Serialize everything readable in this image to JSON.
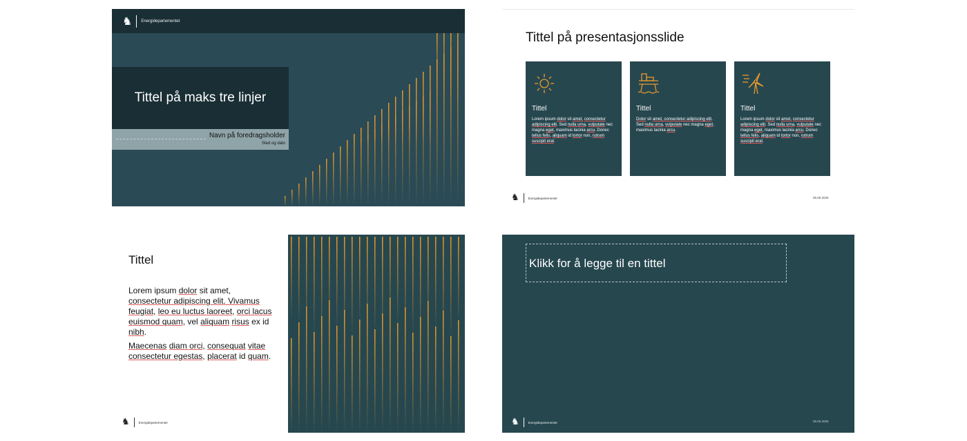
{
  "slide1": {
    "org": "Energidepartementet",
    "title": "Tittel på maks tre linjer",
    "speaker": "Navn på foredragsholder",
    "place_date": "Sted og dato"
  },
  "slide2": {
    "title": "Tittel på presentasjonsslide",
    "cards": [
      {
        "icon": "sun-icon",
        "title": "Tittel",
        "parts": [
          [
            "Lorem ipsum ",
            0
          ],
          [
            "dolor",
            1
          ],
          [
            " sit ",
            0
          ],
          [
            "amet,",
            1
          ],
          [
            " ",
            0
          ],
          [
            "consectetur adipiscing elit",
            1
          ],
          [
            ". Sed ",
            0
          ],
          [
            "nulla urna",
            1
          ],
          [
            ", ",
            0
          ],
          [
            "vulputate",
            1
          ],
          [
            " nec magna ",
            0
          ],
          [
            "eget",
            1
          ],
          [
            ", maximus lacinia ",
            0
          ],
          [
            "arcu",
            1
          ],
          [
            ". Donec ",
            0
          ],
          [
            "tellus felis",
            1
          ],
          [
            ", ",
            0
          ],
          [
            "aliquam",
            1
          ],
          [
            " id ",
            0
          ],
          [
            "tortor",
            1
          ],
          [
            " non, ",
            0
          ],
          [
            "rutrum suscipit erat",
            1
          ],
          [
            ".",
            0
          ]
        ]
      },
      {
        "icon": "oil-platform-icon",
        "title": "Tittel",
        "parts": [
          [
            "Dolor",
            1
          ],
          [
            " sit ",
            0
          ],
          [
            "amet, consectetur adipiscing elit",
            1
          ],
          [
            ". Sed ",
            0
          ],
          [
            "nulla urna",
            1
          ],
          [
            ", ",
            0
          ],
          [
            "vulputate",
            1
          ],
          [
            " nec magna ",
            0
          ],
          [
            "eget",
            1
          ],
          [
            ", maximus lacinia ",
            0
          ],
          [
            "arcu",
            1
          ],
          [
            ".",
            0
          ]
        ]
      },
      {
        "icon": "wind-turbine-icon",
        "title": "Tittel",
        "parts": [
          [
            "Lorem ipsum ",
            0
          ],
          [
            "dolor",
            1
          ],
          [
            " sit ",
            0
          ],
          [
            "amet,",
            1
          ],
          [
            " ",
            0
          ],
          [
            "consectetur adipiscing elit",
            1
          ],
          [
            ". Sed ",
            0
          ],
          [
            "nulla urna",
            1
          ],
          [
            ", ",
            0
          ],
          [
            "vulputate",
            1
          ],
          [
            " nec magna ",
            0
          ],
          [
            "eget",
            1
          ],
          [
            ", maximus lacinia ",
            0
          ],
          [
            "arcu",
            1
          ],
          [
            ". Donec ",
            0
          ],
          [
            "tellus felis",
            1
          ],
          [
            ", ",
            0
          ],
          [
            "aliquam",
            1
          ],
          [
            " id ",
            0
          ],
          [
            "tortor",
            1
          ],
          [
            " non, ",
            0
          ],
          [
            "rutrum suscipit erat",
            1
          ],
          [
            ".",
            0
          ]
        ]
      }
    ],
    "org": "Energidepartementet",
    "date": "05.05.2025"
  },
  "slide3": {
    "title": "Tittel",
    "paragraphs": [
      [
        [
          "Lorem ipsum ",
          0
        ],
        [
          "dolor",
          1
        ],
        [
          " sit amet, ",
          0
        ],
        [
          "consectetur adipiscing elit. Vivamus feugiat",
          1
        ],
        [
          ", ",
          0
        ],
        [
          "leo eu luctus laoreet",
          1
        ],
        [
          ", ",
          0
        ],
        [
          "orci lacus euismod quam",
          1
        ],
        [
          ", vel ",
          0
        ],
        [
          "aliquam",
          1
        ],
        [
          " ",
          0
        ],
        [
          "risus",
          1
        ],
        [
          " ex id ",
          0
        ],
        [
          "nibh",
          1
        ],
        [
          ".",
          0
        ]
      ],
      [
        [
          "Maecenas",
          1
        ],
        [
          " ",
          0
        ],
        [
          "diam orci",
          1
        ],
        [
          ", ",
          0
        ],
        [
          "consequat",
          1
        ],
        [
          " ",
          0
        ],
        [
          "vitae consectetur egestas",
          1
        ],
        [
          ", ",
          0
        ],
        [
          "placerat",
          1
        ],
        [
          " id ",
          0
        ],
        [
          "quam",
          1
        ],
        [
          ".",
          0
        ]
      ]
    ],
    "org": "Energidepartementet"
  },
  "slide4": {
    "title_placeholder": "Klikk for å legge til en tittel",
    "org": "Energidepartementet",
    "date": "05.05.2025"
  },
  "colors": {
    "petrol": "#27474f",
    "dark_petrol": "#1a2f35",
    "grey_band": "#8fa4a8",
    "accent_orange": "#e89a2c"
  }
}
